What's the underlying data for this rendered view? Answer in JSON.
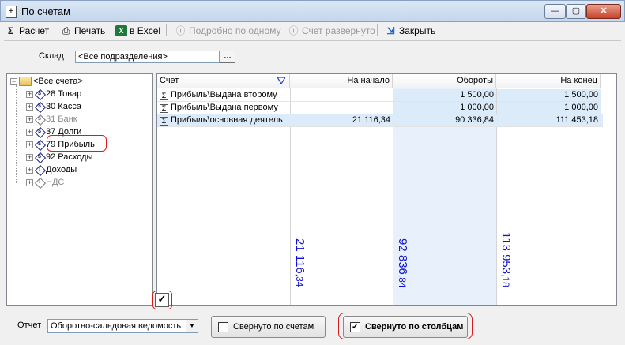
{
  "window": {
    "title": "По счетам",
    "min_glyph": "—",
    "max_glyph": "▢",
    "close_glyph": "✕"
  },
  "toolbar": {
    "calc": "Расчет",
    "print": "Печать",
    "excel": "в Excel",
    "detail_one": "Подробно по одному",
    "expanded": "Счет развернуто",
    "close": "Закрыть"
  },
  "filters": {
    "sklad_label": "Склад",
    "sklad_value": "<Все подразделения>",
    "dots": "..."
  },
  "tree": {
    "root": "<Все счета>",
    "items": [
      {
        "label": "28 Товар",
        "enabled": true
      },
      {
        "label": "30 Касса",
        "enabled": true
      },
      {
        "label": "31 Банк",
        "enabled": false
      },
      {
        "label": "37 Долги",
        "enabled": true
      },
      {
        "label": "79 Прибыль",
        "enabled": true
      },
      {
        "label": "92 Расходы",
        "enabled": true
      },
      {
        "label": "Доходы",
        "enabled": true
      },
      {
        "label": "НДС",
        "enabled": false
      }
    ]
  },
  "grid": {
    "columns": [
      "Счет",
      "На начало",
      "Обороты",
      "На конец"
    ],
    "rows": [
      {
        "account": "Прибыль\\Выдана второму",
        "start": "",
        "turnover": "1 500,00",
        "end": "1 500,00"
      },
      {
        "account": "Прибыль\\Выдана первому",
        "start": "",
        "turnover": "1 000,00",
        "end": "1 000,00"
      },
      {
        "account": "Прибыль\\основная деятель",
        "start": "21 116,34",
        "turnover": "90 336,84",
        "end": "111 453,18"
      }
    ],
    "totals": {
      "start_int": "21 116",
      "start_frac": ",34",
      "turnover_int": "92 836",
      "turnover_frac": ",84",
      "end_int": "113 953",
      "end_frac": ",18"
    }
  },
  "bottom": {
    "report_label": "Отчет",
    "report_value": "Оборотно-сальдовая ведомость",
    "collapsed_accounts": "Свернуто по счетам",
    "collapsed_columns": "Свернуто по столбцам"
  }
}
